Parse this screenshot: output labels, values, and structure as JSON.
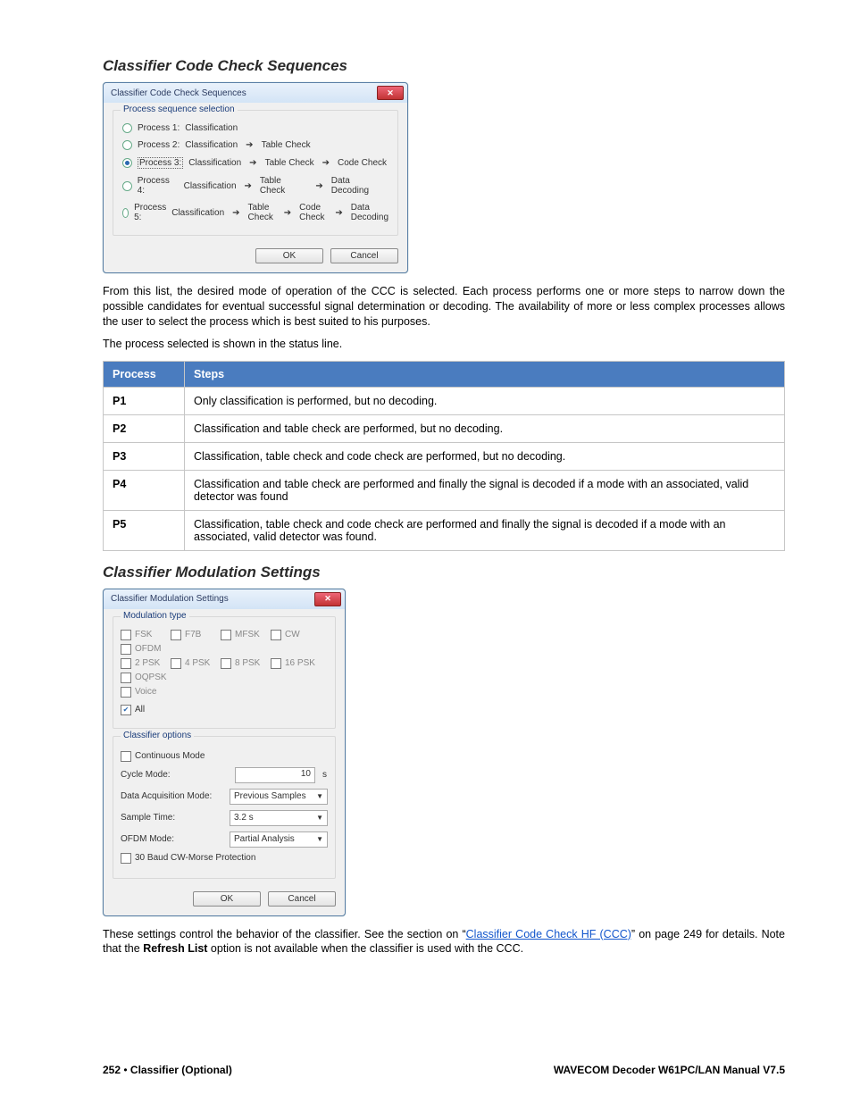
{
  "heading1": "Classifier Code Check Sequences",
  "dlg1": {
    "title": "Classifier Code Check Sequences",
    "legend": "Process sequence selection",
    "rows": [
      {
        "label": "Process 1:",
        "steps": [
          "Classification"
        ],
        "selected": false
      },
      {
        "label": "Process 2:",
        "steps": [
          "Classification",
          "Table Check"
        ],
        "selected": false
      },
      {
        "label": "Process 3:",
        "steps": [
          "Classification",
          "Table Check",
          "Code Check"
        ],
        "selected": true
      },
      {
        "label": "Process 4:",
        "steps": [
          "Classification",
          "Table Check",
          "Data Decoding"
        ],
        "selected": false
      },
      {
        "label": "Process 5:",
        "steps": [
          "Classification",
          "Table Check",
          "Code Check",
          "Data Decoding"
        ],
        "selected": false
      }
    ],
    "ok": "OK",
    "cancel": "Cancel"
  },
  "para1": "From this list, the desired mode of operation of the CCC is selected. Each process performs one or more steps to narrow down the possible candidates for eventual successful signal determination or decoding. The availability of more or less complex processes allows the user to select the process which is best suited to his purposes.",
  "para2": "The process selected is shown in the status line.",
  "table": {
    "h1": "Process",
    "h2": "Steps",
    "rows": [
      {
        "p": "P1",
        "s": "Only classification is performed, but no decoding."
      },
      {
        "p": "P2",
        "s": "Classification and table check are performed, but no decoding."
      },
      {
        "p": "P3",
        "s": "Classification, table check and code check are performed, but no decoding."
      },
      {
        "p": "P4",
        "s": "Classification and table check are performed and finally the signal is decoded if a mode with an associated, valid detector was found"
      },
      {
        "p": "P5",
        "s": "Classification, table check and code check are performed and finally the signal is decoded if a mode with an associated, valid detector was found."
      }
    ]
  },
  "heading2": "Classifier Modulation Settings",
  "dlg2": {
    "title": "Classifier Modulation Settings",
    "legend1": "Modulation type",
    "mods1": [
      "FSK",
      "F7B",
      "MFSK",
      "CW",
      "OFDM"
    ],
    "mods2": [
      "2 PSK",
      "4 PSK",
      "8 PSK",
      "16 PSK",
      "OQPSK"
    ],
    "voice": "Voice",
    "all": "All",
    "legend2": "Classifier options",
    "continuous": "Continuous Mode",
    "cycle_label": "Cycle Mode:",
    "cycle_value": "10",
    "cycle_unit": "s",
    "dam_label": "Data Acquisition Mode:",
    "dam_value": "Previous Samples",
    "st_label": "Sample Time:",
    "st_value": "3.2 s",
    "ofdm_label": "OFDM Mode:",
    "ofdm_value": "Partial Analysis",
    "morse": "30 Baud CW-Morse Protection",
    "ok": "OK",
    "cancel": "Cancel"
  },
  "para3a": "These settings control the behavior of the classifier. See the section on “",
  "para3_link": "Classifier Code Check HF (CCC)",
  "para3b": "” on page 249 for details. Note that the ",
  "para3_bold": "Refresh List",
  "para3c": " option is not available when the classifier is used with the CCC.",
  "footer": {
    "left_page": "252",
    "left_sep": "  •  ",
    "left_section": "Classifier (Optional)",
    "right": "WAVECOM Decoder W61PC/LAN Manual V7.5"
  }
}
